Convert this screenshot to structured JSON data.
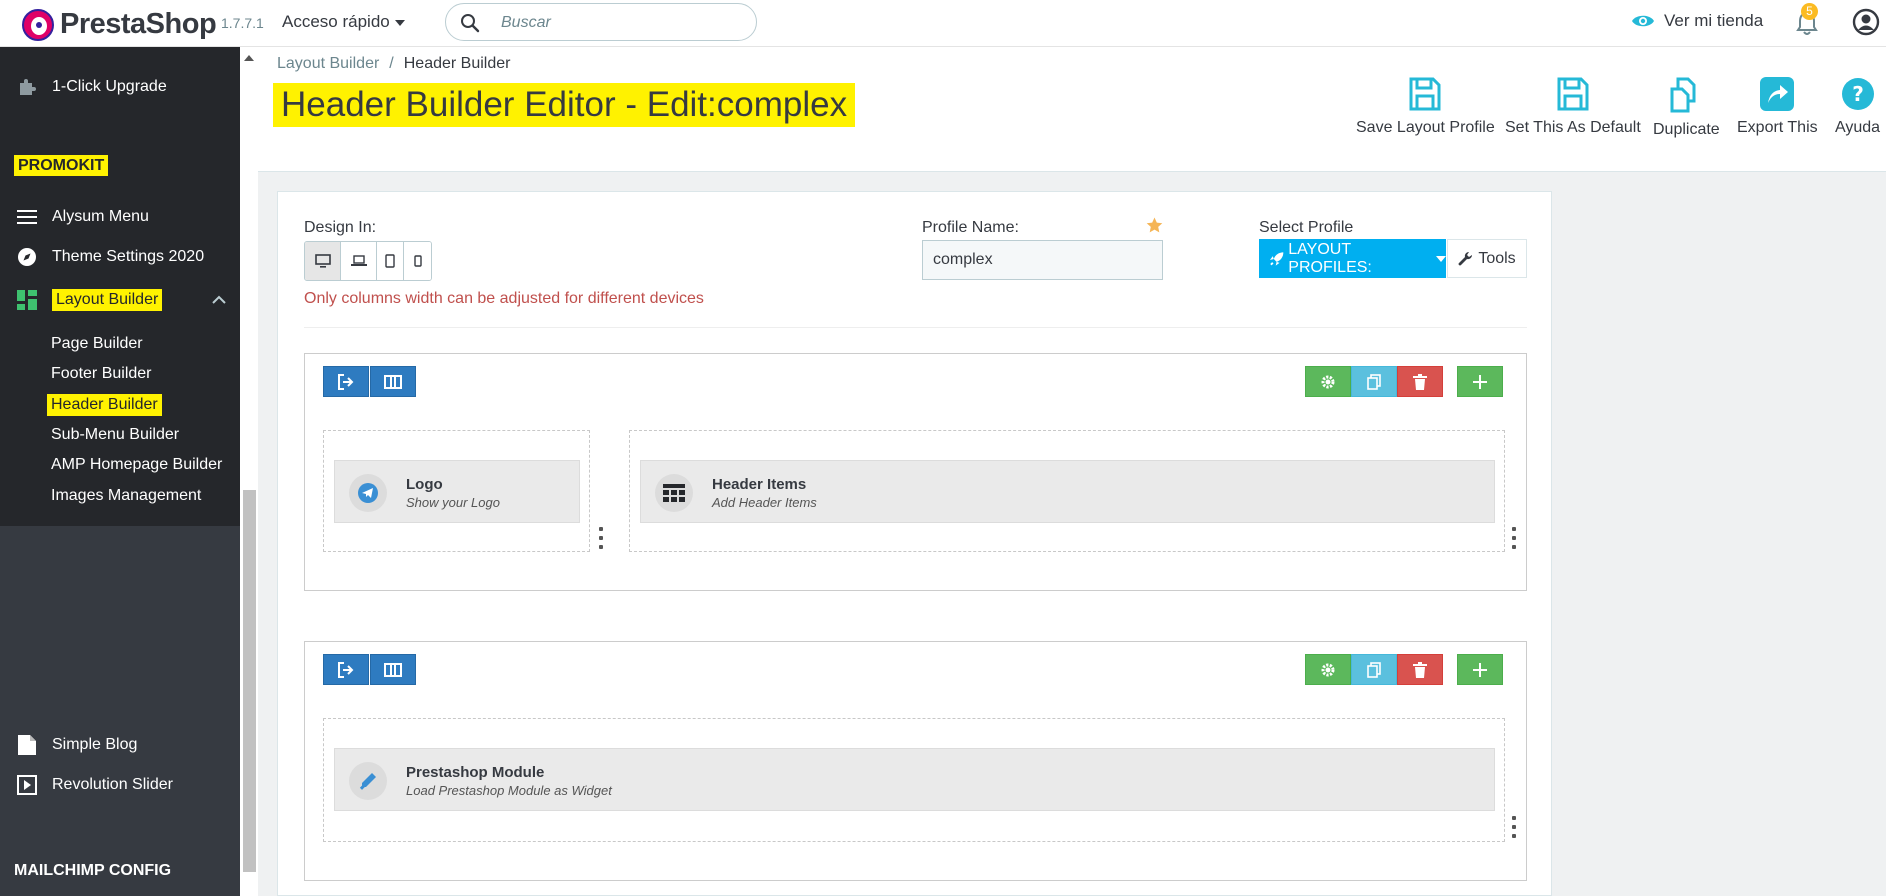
{
  "topbar": {
    "brand": "PrestaShop",
    "version": "1.7.7.1",
    "quick_access": "Acceso rápido",
    "search_placeholder": "Buscar",
    "view_shop": "Ver mi tienda",
    "notifications_count": "5"
  },
  "sidebar": {
    "upgrade": "1-Click Upgrade",
    "section_promokit": "PROMOKIT",
    "items": [
      {
        "label": "Alysum Menu",
        "icon": "menu-icon"
      },
      {
        "label": "Theme Settings 2020",
        "icon": "compass-icon"
      },
      {
        "label": "Layout Builder",
        "icon": "dashboard-icon"
      }
    ],
    "submenu": [
      "Page Builder",
      "Footer Builder",
      "Header Builder",
      "Sub-Menu Builder",
      "AMP Homepage Builder",
      "Images Management"
    ],
    "simple_blog": "Simple Blog",
    "revolution_slider": "Revolution Slider",
    "section_mailchimp": "MAILCHIMP CONFIG"
  },
  "header": {
    "breadcrumb": [
      "Layout Builder",
      "Header Builder"
    ],
    "breadcrumb_sep": "/",
    "title": "Header Builder Editor - Edit:complex",
    "toolbar": [
      "Save Layout Profile",
      "Set This As Default",
      "Duplicate",
      "Export This",
      "Ayuda"
    ]
  },
  "editor": {
    "design_in_label": "Design In:",
    "warning": "Only columns width can be adjusted for different devices",
    "profile_name_label": "Profile Name:",
    "profile_name_value": "complex",
    "select_profile_label": "Select Profile",
    "layout_profiles_btn": "LAYOUT PROFILES:",
    "tools_btn": "Tools"
  },
  "rows": [
    {
      "widgets": [
        {
          "title": "Logo",
          "desc": "Show your Logo",
          "icon": "telegram-icon"
        },
        {
          "title": "Header Items",
          "desc": "Add Header Items",
          "icon": "grid-icon"
        }
      ]
    },
    {
      "widgets": [
        {
          "title": "Prestashop Module",
          "desc": "Load Prestashop Module as Widget",
          "icon": "plug-icon"
        }
      ]
    }
  ],
  "colors": {
    "accent": "#25b9d7",
    "highlight": "#fff200",
    "primary_btn": "#00aff0",
    "sidebar_dark": "#25272b"
  }
}
